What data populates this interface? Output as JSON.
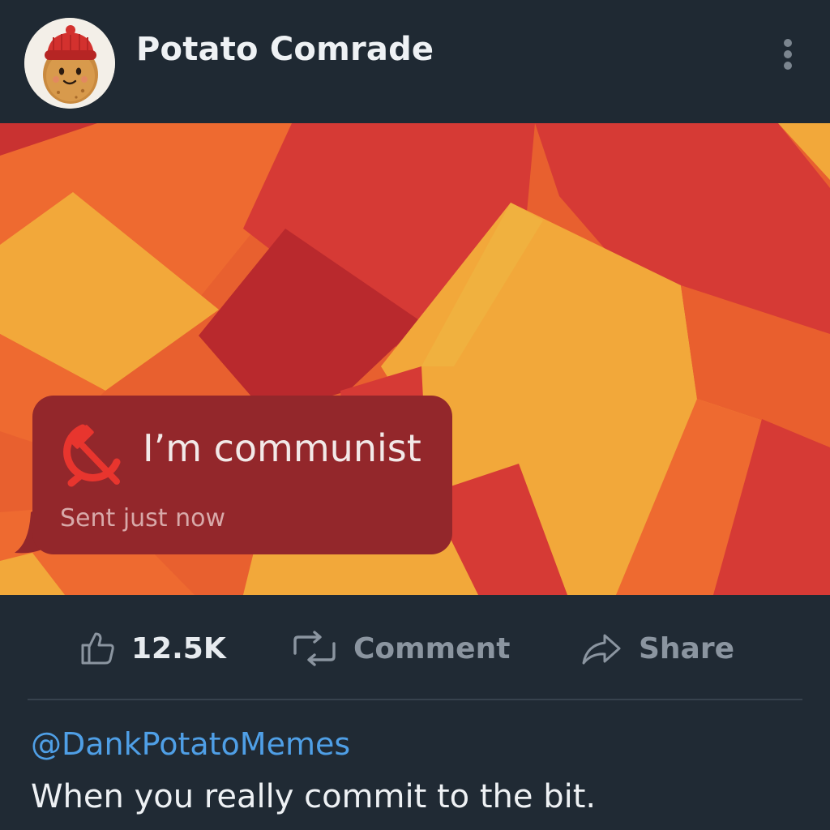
{
  "header": {
    "username": "Potato Comrade",
    "avatar_icon": "potato-with-red-beanie",
    "menu_icon": "vertical-ellipsis-icon"
  },
  "post": {
    "message_bubble": {
      "text": "I’m communist",
      "timestamp": "Sent just now",
      "icon": "hammer-and-sickle-icon",
      "bubble_color": "#93272b"
    },
    "background_palette": [
      "#d63a35",
      "#ee6a2f",
      "#f2a83a",
      "#b9292d"
    ]
  },
  "actions": {
    "like_count": "12.5K",
    "comment_label": "Comment",
    "share_label": "Share"
  },
  "caption": {
    "handle": "@DankPotatoMemes",
    "text": "When you really commit to the bit."
  },
  "colors": {
    "background": "#202a34",
    "handle": "#4f9fe6",
    "text": "#eef1f4",
    "muted": "#8b95a0"
  }
}
